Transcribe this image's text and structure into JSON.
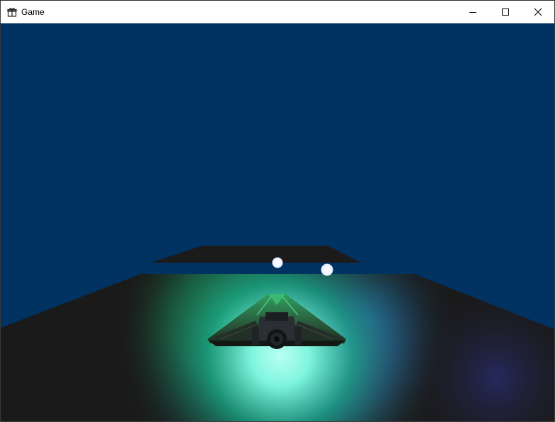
{
  "window": {
    "title": "Game",
    "app_icon": "gift-icon",
    "controls": [
      {
        "name": "minimize-button",
        "icon": "minimize-icon"
      },
      {
        "name": "maximize-button",
        "icon": "maximize-icon"
      },
      {
        "name": "close-button",
        "icon": "close-icon"
      }
    ]
  },
  "scene": {
    "sky_color": "#003262",
    "ground_color": "#1a1a1a",
    "platform_color": "#1b1b1b",
    "light_colors": [
      "#ffffff",
      "#ffffff"
    ],
    "glow_colors": [
      "#46ff9a",
      "#a6ffef",
      "#5c7bff",
      "#1e4fbf"
    ],
    "objects": [
      "floor-platform",
      "distant-platform",
      "light-orb",
      "light-orb",
      "spaceship"
    ]
  }
}
